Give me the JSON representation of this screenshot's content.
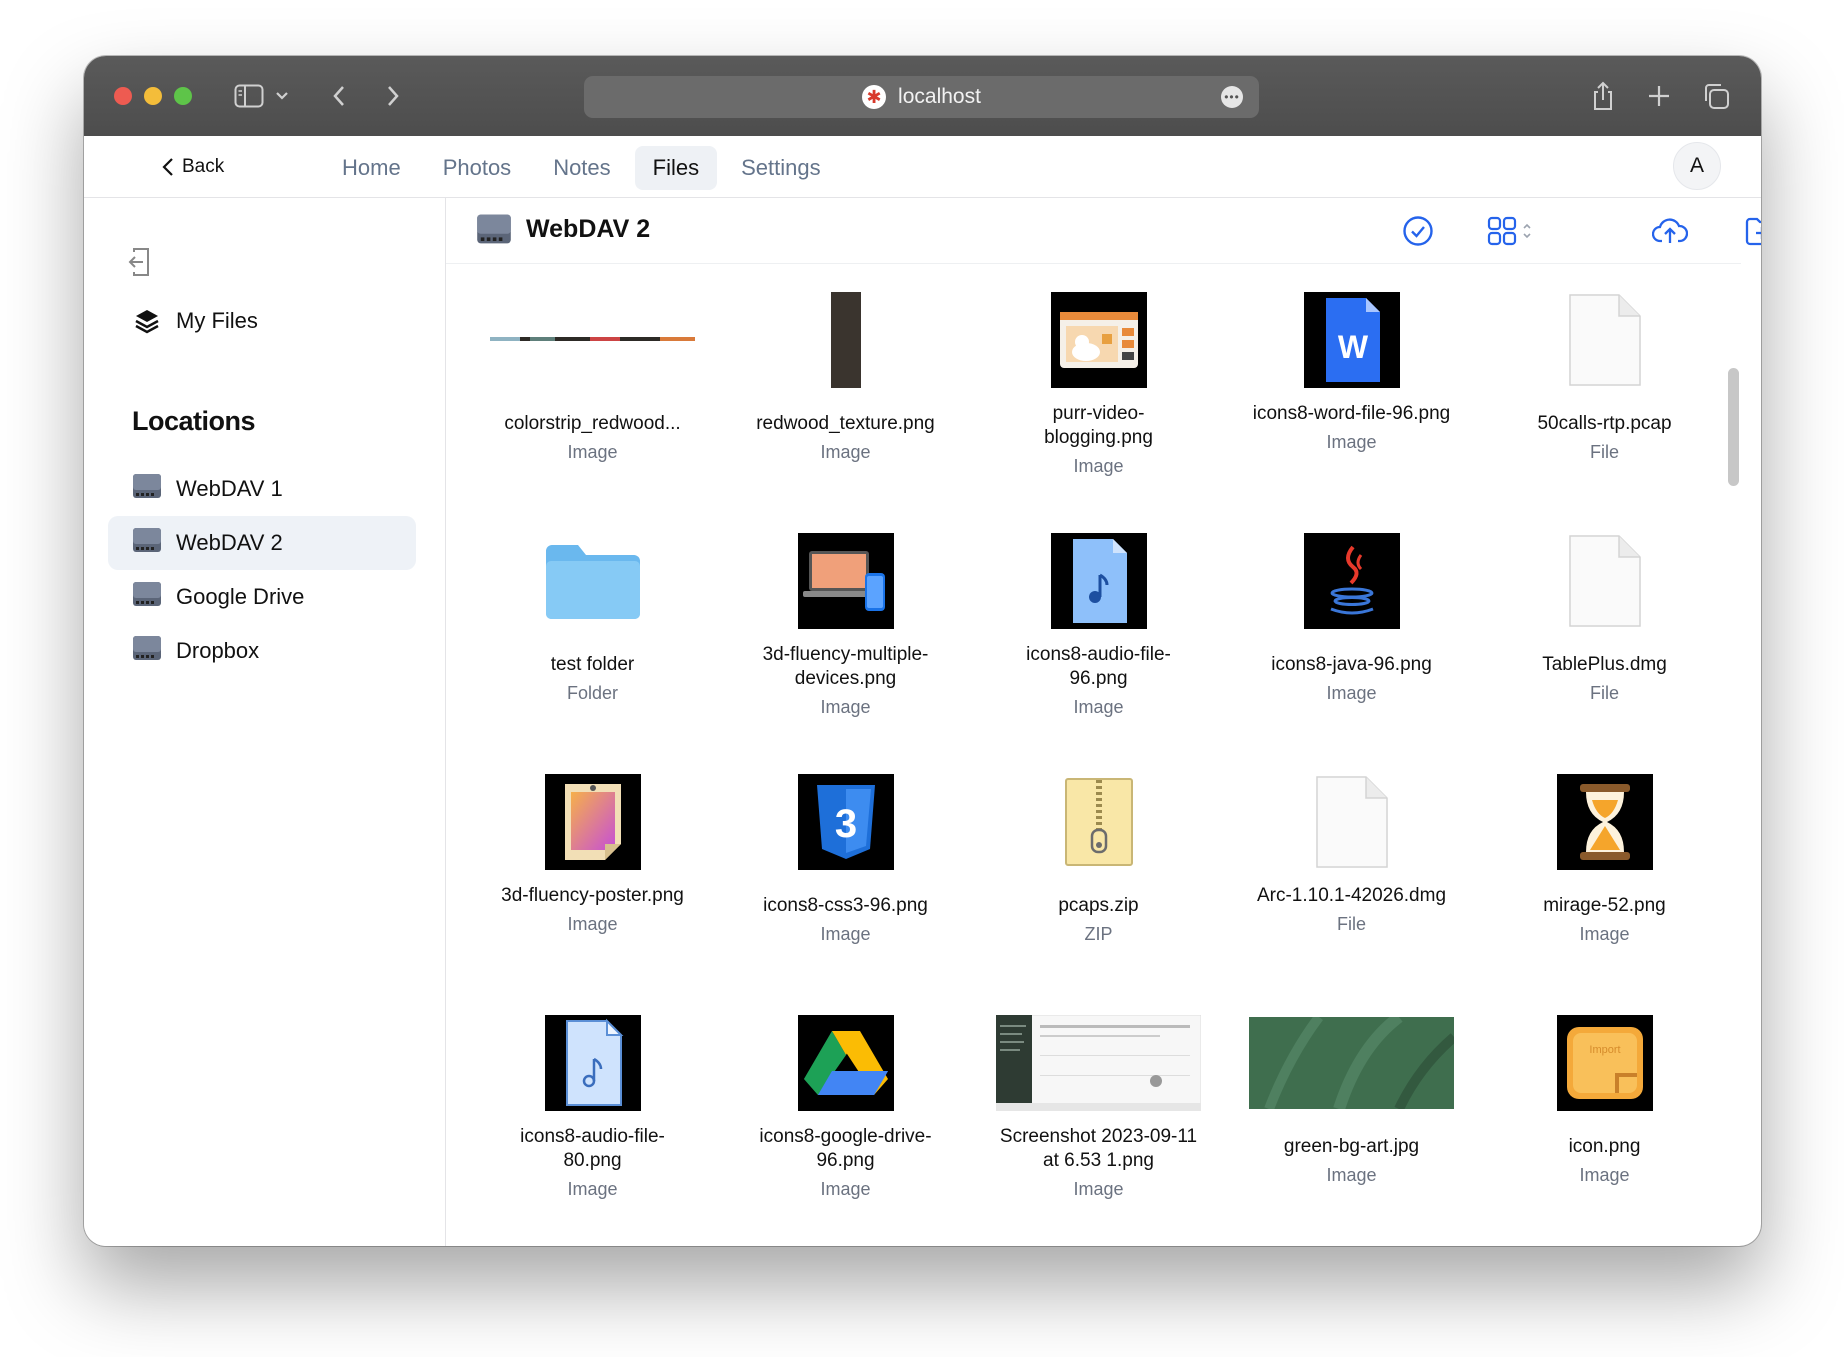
{
  "browser": {
    "url": "localhost"
  },
  "nav": {
    "back_label": "Back",
    "tabs": [
      {
        "label": "Home",
        "active": false
      },
      {
        "label": "Photos",
        "active": false
      },
      {
        "label": "Notes",
        "active": false
      },
      {
        "label": "Files",
        "active": true
      },
      {
        "label": "Settings",
        "active": false
      }
    ],
    "avatar_initial": "A"
  },
  "sidebar": {
    "my_files_label": "My Files",
    "locations_heading": "Locations",
    "locations": [
      {
        "label": "WebDAV 1",
        "active": false
      },
      {
        "label": "WebDAV 2",
        "active": true
      },
      {
        "label": "Google Drive",
        "active": false
      },
      {
        "label": "Dropbox",
        "active": false
      }
    ]
  },
  "main": {
    "title": "WebDAV 2",
    "files": [
      {
        "name": "colorstrip_redwood...",
        "type": "Image",
        "thumb": "colorstrip"
      },
      {
        "name": "redwood_texture.png",
        "type": "Image",
        "thumb": "redwood"
      },
      {
        "name": "purr-video-blogging.png",
        "type": "Image",
        "thumb": "purr"
      },
      {
        "name": "icons8-word-file-96.png",
        "type": "Image",
        "thumb": "word"
      },
      {
        "name": "50calls-rtp.pcap",
        "type": "File",
        "thumb": "generic-file"
      },
      {
        "name": "test folder",
        "type": "Folder",
        "thumb": "folder"
      },
      {
        "name": "3d-fluency-multiple-devices.png",
        "type": "Image",
        "thumb": "devices"
      },
      {
        "name": "icons8-audio-file-96.png",
        "type": "Image",
        "thumb": "audio96"
      },
      {
        "name": "icons8-java-96.png",
        "type": "Image",
        "thumb": "java"
      },
      {
        "name": "TablePlus.dmg",
        "type": "File",
        "thumb": "generic-file"
      },
      {
        "name": "3d-fluency-poster.png",
        "type": "Image",
        "thumb": "poster"
      },
      {
        "name": "icons8-css3-96.png",
        "type": "Image",
        "thumb": "css3"
      },
      {
        "name": "pcaps.zip",
        "type": "ZIP",
        "thumb": "zip"
      },
      {
        "name": "Arc-1.10.1-42026.dmg",
        "type": "File",
        "thumb": "generic-file"
      },
      {
        "name": "mirage-52.png",
        "type": "Image",
        "thumb": "hourglass"
      },
      {
        "name": "icons8-audio-file-80.png",
        "type": "Image",
        "thumb": "audio80"
      },
      {
        "name": "icons8-google-drive-96.png",
        "type": "Image",
        "thumb": "gdrive"
      },
      {
        "name": "Screenshot 2023-09-11 at 6.53 1.png",
        "type": "Image",
        "thumb": "screenshot"
      },
      {
        "name": "green-bg-art.jpg",
        "type": "Image",
        "thumb": "green"
      },
      {
        "name": "icon.png",
        "type": "Image",
        "thumb": "import-icon",
        "thumb_text": "Import"
      }
    ]
  },
  "colors": {
    "accent": "#2563eb",
    "window_chrome": "#505050",
    "active_bg": "#eef2f7"
  }
}
